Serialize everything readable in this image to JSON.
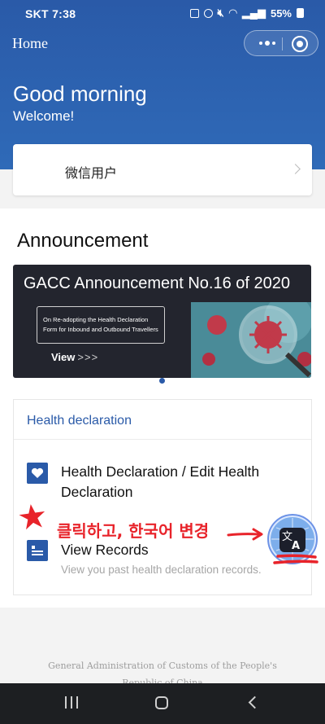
{
  "status_bar": {
    "carrier_time": "SKT 7:38",
    "battery": "55%"
  },
  "navbar": {
    "title": "Home"
  },
  "header": {
    "greeting": "Good morning",
    "welcome": "Welcome!"
  },
  "user_card": {
    "name": "微信用户"
  },
  "announcement": {
    "section_title": "Announcement",
    "banner": {
      "title": "GACC Announcement No.16 of 2020",
      "box_line1": "On Re-adopting the Health Declaration",
      "box_line2": "Form for Inbound and Outbound Travellers",
      "view_label": "View",
      "view_arrows": ">>>"
    }
  },
  "health": {
    "title": "Health declaration",
    "items": [
      {
        "label": "Health Declaration / Edit Health Declaration",
        "icon": "heart-icon"
      },
      {
        "label": "View Records",
        "sub": "View you past health declaration records.",
        "icon": "records-icon"
      }
    ]
  },
  "annotation": {
    "text": "클릭하고, 한국어 변경",
    "color": "#e8232a"
  },
  "translate": {
    "glyph_zh": "文",
    "glyph_a": "A"
  },
  "footer": {
    "line1": "General Administration of Customs of the People's",
    "line2": "Republic of China"
  },
  "colors": {
    "brand_blue": "#2a5aa8"
  }
}
